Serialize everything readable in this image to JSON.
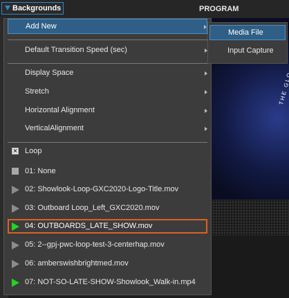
{
  "topbar": {
    "backgrounds_label": "Backgrounds",
    "program_label": "PROGRAM"
  },
  "menu": {
    "add_new": "Add New",
    "transition_speed": "Default Transition Speed (sec)",
    "display_space": "Display Space",
    "stretch": "Stretch",
    "horizontal_alignment": "Horizontal Alignment",
    "vertical_alignment": "VerticalAlignment",
    "loop": "Loop",
    "loop_checked": true,
    "media": [
      {
        "label": "01: None",
        "icon": "none-square-icon"
      },
      {
        "label": "02: Showlook-Loop-GXC2020-Logo-Title.mov",
        "icon": "play-icon"
      },
      {
        "label": "03: Outboard Loop_Left_GXC2020.mov",
        "icon": "play-icon"
      },
      {
        "label": "04: OUTBOARDS_LATE_SHOW.mov",
        "icon": "play-icon-green",
        "selected": true
      },
      {
        "label": "05: 2--gpj-pwc-loop-test-3-centerhap.mov",
        "icon": "play-icon"
      },
      {
        "label": "06: amberswishbrightmed.mov",
        "icon": "play-icon"
      },
      {
        "label": "07: NOT-SO-LATE-SHOW-Showlook_Walk-in.mp4",
        "icon": "play-icon-green"
      }
    ]
  },
  "submenu": {
    "media_file": "Media File",
    "input_capture": "Input Capture"
  },
  "colors": {
    "accent_blue": "#2f88c6",
    "highlight": "#2f5f87",
    "selected_border": "#e0601f",
    "play_green": "#23d323"
  },
  "program_glow_text": "THE GLO"
}
